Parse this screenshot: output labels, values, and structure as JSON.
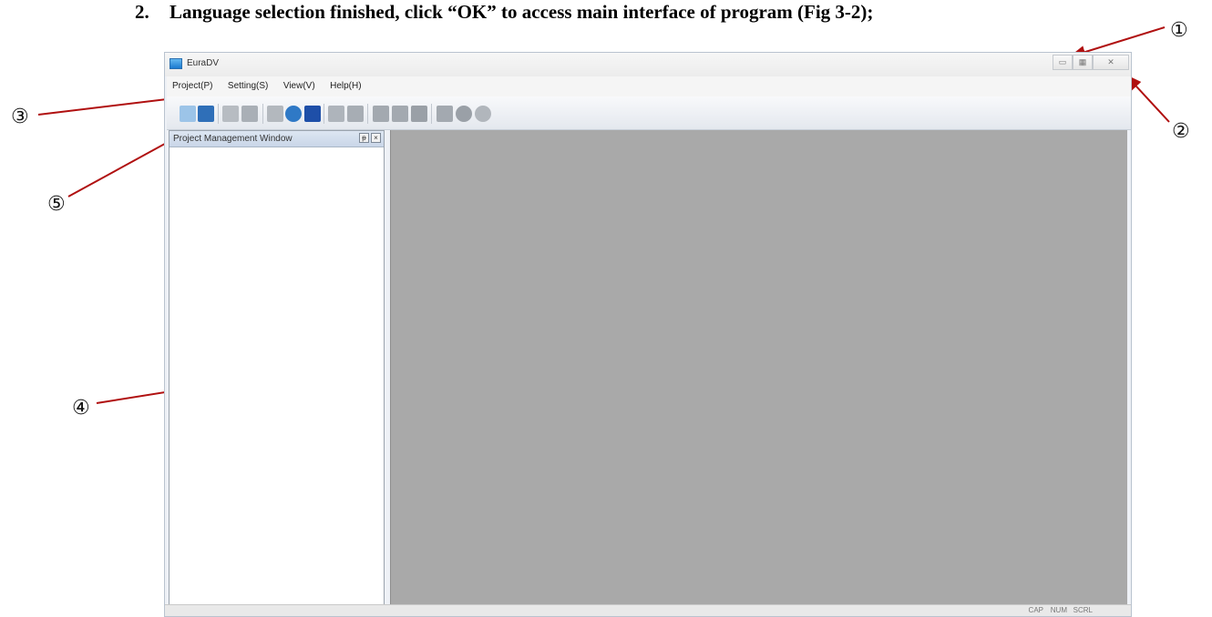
{
  "heading": {
    "number": "2.",
    "text": "Language selection finished, click “OK” to access main interface of program (Fig 3-2);"
  },
  "callouts": [
    "①",
    "②",
    "③",
    "④",
    "⑤"
  ],
  "window": {
    "title": "EuraDV",
    "controls": {
      "min": "▭",
      "max": "▦",
      "close": "✕"
    },
    "menu": [
      "Project(P)",
      "Setting(S)",
      "View(V)",
      "Help(H)"
    ],
    "toolbar_icons": [
      {
        "name": "new-project-icon",
        "color": "#9cc4e8"
      },
      {
        "name": "open-project-icon",
        "color": "#2f6fb8"
      },
      {
        "name": "save-icon",
        "color": "#b7bcc2"
      },
      {
        "name": "save-all-icon",
        "color": "#a9afb6"
      },
      {
        "name": "device-icon",
        "color": "#b3b8be"
      },
      {
        "name": "connect-icon",
        "color": "#2f79c6"
      },
      {
        "name": "lock-icon",
        "color": "#1e4fa8"
      },
      {
        "name": "window-icon",
        "color": "#aeb4bb"
      },
      {
        "name": "grid-icon",
        "color": "#a7adb4"
      },
      {
        "name": "chart-icon",
        "color": "#a3a9b0"
      },
      {
        "name": "list-icon",
        "color": "#a3a9b0"
      },
      {
        "name": "edit-icon",
        "color": "#9aa0a7"
      },
      {
        "name": "tree-icon",
        "color": "#a3a9b0"
      },
      {
        "name": "stop-icon",
        "color": "#9aa0a7"
      },
      {
        "name": "history-icon",
        "color": "#b1b6bc"
      }
    ],
    "project_panel": {
      "title": "Project Management Window",
      "pin": "ᵽ",
      "close": "×"
    },
    "status": [
      "CAP",
      "NUM",
      "SCRL"
    ]
  },
  "colors": {
    "arrow": "#b01010",
    "workspace": "#a9a9a9"
  }
}
